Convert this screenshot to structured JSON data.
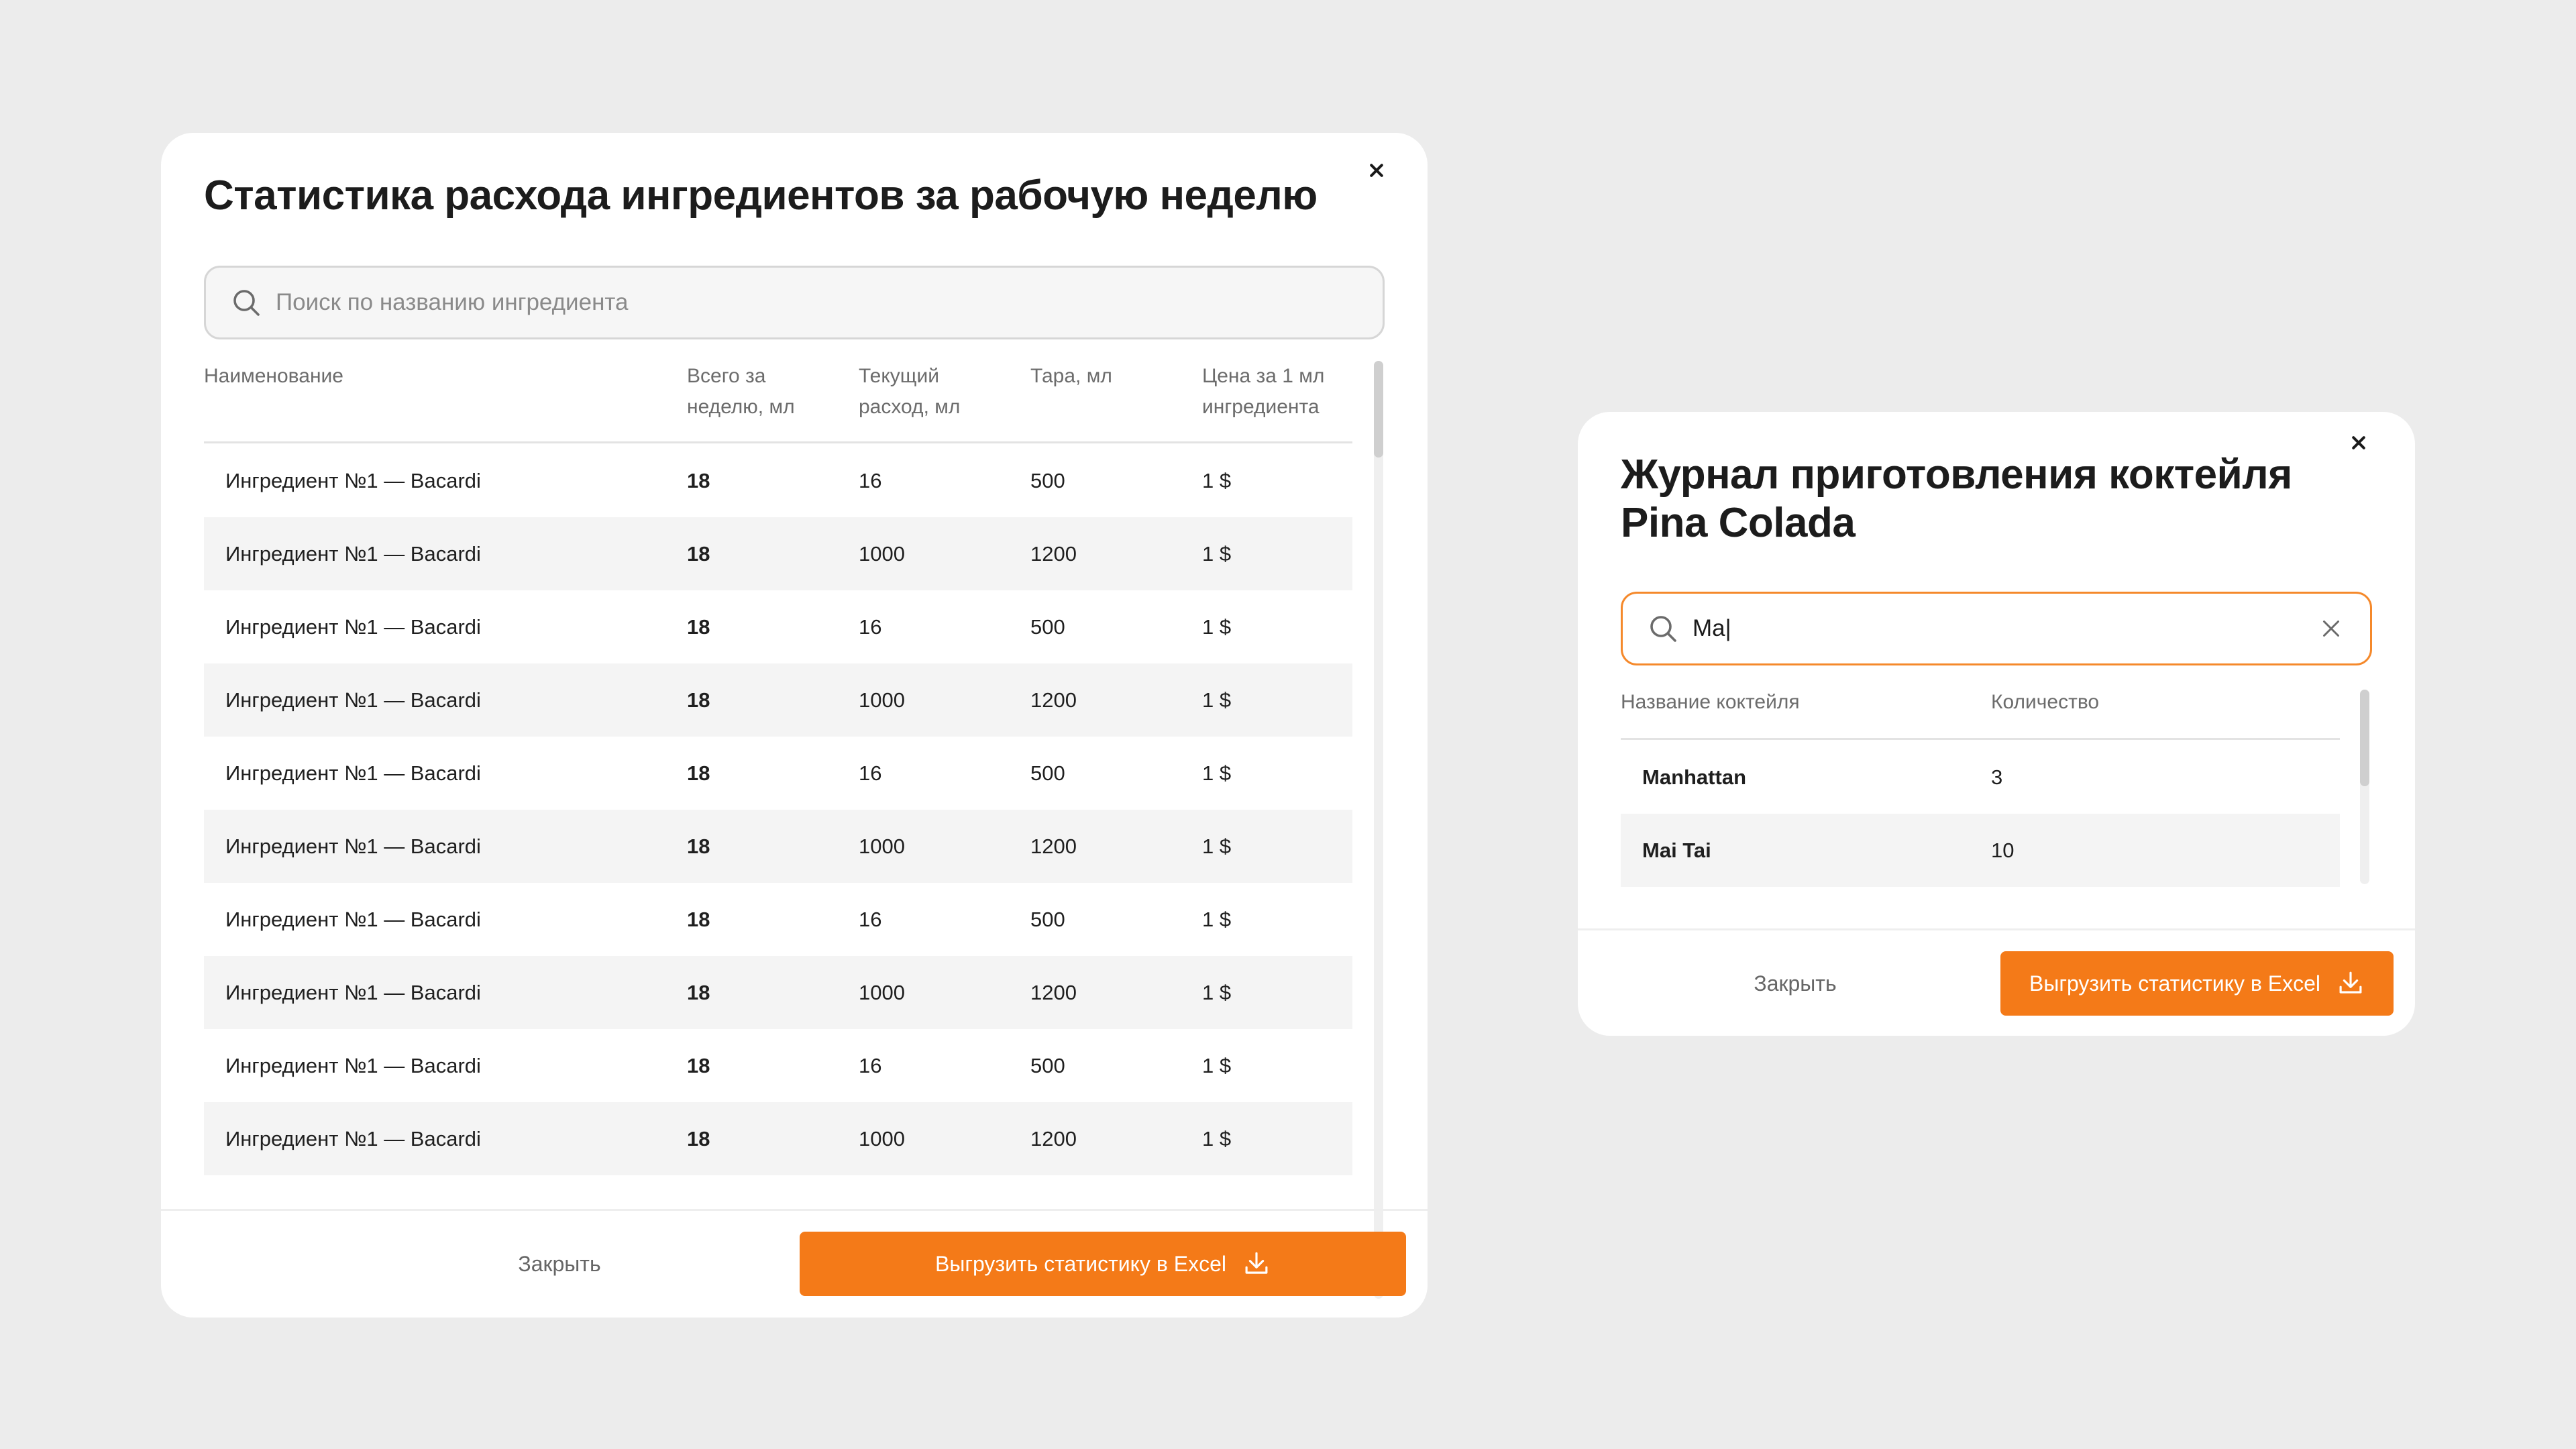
{
  "stats_modal": {
    "title": "Статистика расхода ингредиентов за рабочую неделю",
    "search_placeholder": "Поиск по названию ингредиента",
    "columns": [
      "Наименование",
      "Всего за неделю, мл",
      "Текущий расход, мл",
      "Тара, мл",
      "Цена за 1 мл ингредиента"
    ],
    "rows": [
      [
        "Ингредиент №1 — Bacardi",
        "18",
        "16",
        "500",
        "1 $"
      ],
      [
        "Ингредиент №1 — Bacardi",
        "18",
        "1000",
        "1200",
        "1 $"
      ],
      [
        "Ингредиент №1 — Bacardi",
        "18",
        "16",
        "500",
        "1 $"
      ],
      [
        "Ингредиент №1 — Bacardi",
        "18",
        "1000",
        "1200",
        "1 $"
      ],
      [
        "Ингредиент №1 — Bacardi",
        "18",
        "16",
        "500",
        "1 $"
      ],
      [
        "Ингредиент №1 — Bacardi",
        "18",
        "1000",
        "1200",
        "1 $"
      ],
      [
        "Ингредиент №1 — Bacardi",
        "18",
        "16",
        "500",
        "1 $"
      ],
      [
        "Ингредиент №1 — Bacardi",
        "18",
        "1000",
        "1200",
        "1 $"
      ],
      [
        "Ингредиент №1 — Bacardi",
        "18",
        "16",
        "500",
        "1 $"
      ],
      [
        "Ингредиент №1 — Bacardi",
        "18",
        "1000",
        "1200",
        "1 $"
      ]
    ],
    "close_label": "Закрыть",
    "export_label": "Выгрузить статистику в Excel"
  },
  "log_modal": {
    "title": "Журнал приготовления коктейля Pina Colada",
    "search_value": "Ma|",
    "columns": [
      "Название коктейля",
      "Количество"
    ],
    "rows": [
      [
        "Manhattan",
        "3"
      ],
      [
        "Mai Tai",
        "10"
      ]
    ],
    "close_label": "Закрыть",
    "export_label": "Выгрузить статистику в Excel"
  },
  "colors": {
    "accent": "#f47a18",
    "active_border": "#f5892b",
    "background": "#ececec"
  },
  "icons": [
    "search-icon",
    "close-icon",
    "clear-icon",
    "download-icon"
  ]
}
